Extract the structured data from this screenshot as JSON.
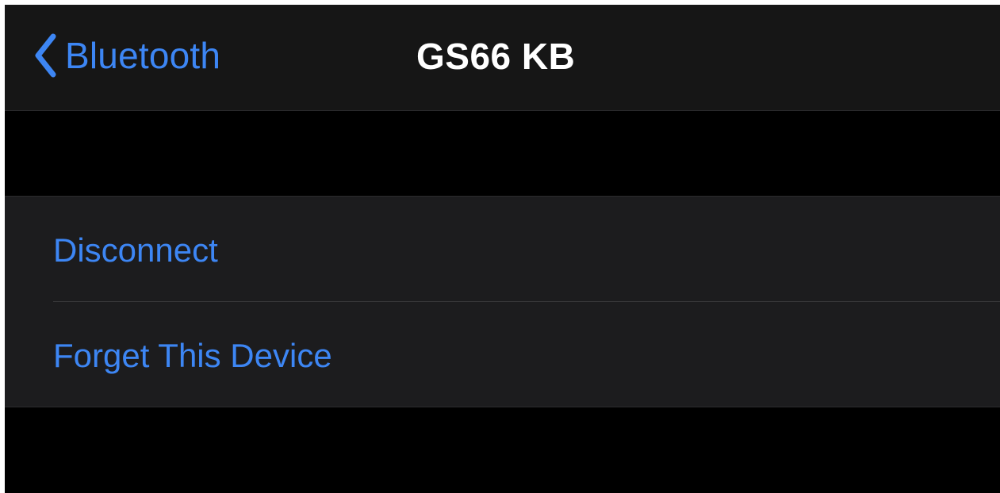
{
  "nav": {
    "back_label": "Bluetooth",
    "title": "GS66 KB"
  },
  "actions": {
    "disconnect_label": "Disconnect",
    "forget_label": "Forget This Device"
  },
  "colors": {
    "accent": "#3d86f4",
    "background": "#000000",
    "nav_background": "#161616",
    "cell_background": "#1c1c1e",
    "title_text": "#ffffff"
  },
  "icons": {
    "back": "chevron-left-icon"
  }
}
